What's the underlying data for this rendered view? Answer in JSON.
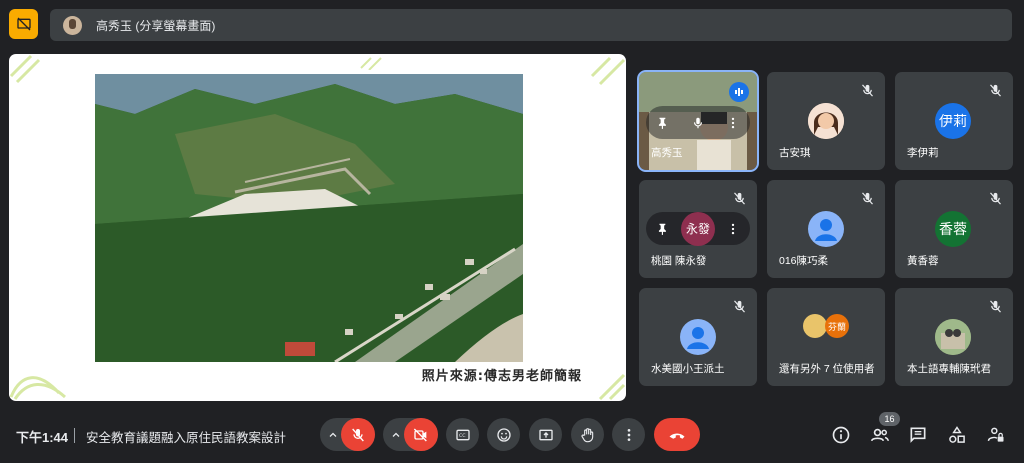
{
  "presenter": {
    "label": "高秀玉 (分享螢幕畫面)"
  },
  "share": {
    "caption": "照片來源:傅志男老師簡報"
  },
  "tiles": [
    {
      "name": "高秀玉",
      "initials": "",
      "speaking": true
    },
    {
      "name": "古安琪",
      "initials": ""
    },
    {
      "name": "李伊莉",
      "initials": "伊莉",
      "color": "#1a73e8"
    },
    {
      "name": "桃園 陳永發",
      "initials": "永發",
      "color": "#8e2f4f"
    },
    {
      "name": "016陳巧柔",
      "initials": ""
    },
    {
      "name": "黃香蓉",
      "initials": "香蓉",
      "color": "#137333"
    },
    {
      "name": "水美國小王派土",
      "initials": ""
    },
    {
      "name": "還有另外 7 位使用者",
      "initials": "芬蘭",
      "color": "#e8710a"
    },
    {
      "name": "本土語專輔陳玳君",
      "initials": ""
    }
  ],
  "bottom": {
    "time": "下午1:44",
    "meeting_title": "安全教育議題融入原住民語教案設計",
    "participant_count": "16"
  },
  "colors": {
    "accent_yellow": "#f9ab00",
    "danger_red": "#ea4335",
    "surface": "#3c4043",
    "background": "#202124"
  }
}
